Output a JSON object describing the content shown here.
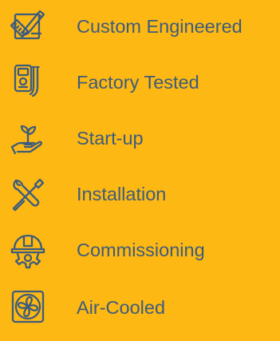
{
  "colors": {
    "background": "#FDB813",
    "foreground": "#3D5C7C"
  },
  "features": [
    {
      "icon": "design-tools-icon",
      "label": "Custom Engineered"
    },
    {
      "icon": "multimeter-icon",
      "label": "Factory Tested"
    },
    {
      "icon": "hand-sprout-icon",
      "label": "Start-up"
    },
    {
      "icon": "wrench-screwdriver-icon",
      "label": "Installation"
    },
    {
      "icon": "hardhat-gear-icon",
      "label": "Commissioning"
    },
    {
      "icon": "fan-icon",
      "label": "Air-Cooled"
    }
  ]
}
